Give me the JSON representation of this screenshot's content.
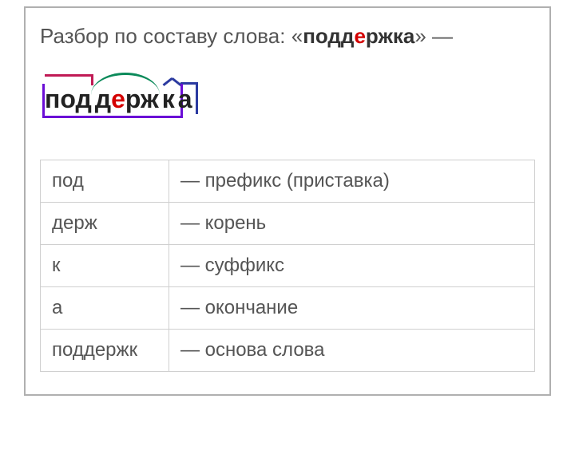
{
  "title": {
    "prefix_text": "Разбор по составу слова: «",
    "word_before_e": "подд",
    "word_e": "е",
    "word_after_e": "ржка",
    "suffix_text": "» —"
  },
  "morpheme": {
    "prefix": "под",
    "root_before_e": "д",
    "root_e": "е",
    "root_after_e": "рж",
    "suffix": "к",
    "ending": "а"
  },
  "table": {
    "rows": [
      {
        "part": "под",
        "desc": "— префикс (приставка)"
      },
      {
        "part": "держ",
        "desc": "— корень"
      },
      {
        "part": "к",
        "desc": "— суффикс"
      },
      {
        "part": "а",
        "desc": "— окончание"
      },
      {
        "part": "поддержк",
        "desc": "— основа слова"
      }
    ]
  }
}
